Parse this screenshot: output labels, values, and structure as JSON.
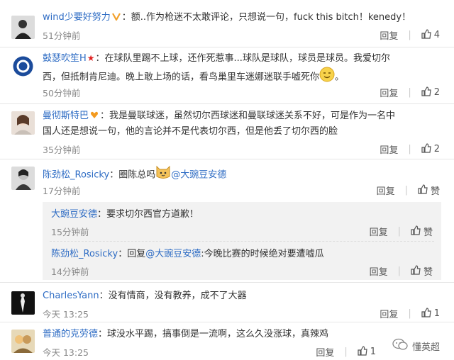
{
  "comments": [
    {
      "name": "wind少要好努力",
      "text": "：额..作为枪迷不太敢评论，只想说一句，fuck this bitch！kenedy！",
      "time": "51分钟前",
      "reply_label": "回复",
      "like_count": "4"
    },
    {
      "name": "鼓瑟吹笙H",
      "text_line1": "：在球队里踢不上球，还作死惹事...球队是球队，球员是球员。我爱切尔",
      "text_line2": "西，但抵制肯尼迪。晚上敢上场的话，看鸟巢里车迷娜迷联手嘘死你",
      "time": "50分钟前",
      "reply_label": "回复",
      "like_count": "2"
    },
    {
      "name": "曼彻斯特巴",
      "text_line1": "：我是曼联球迷，虽然切尔西球迷和曼联球迷关系不好，可是作为一名中",
      "text_line2": "国人还是想说一句，他的言论并不是代表切尔西，但是他丢了切尔西的脸",
      "time": "35分钟前",
      "reply_label": "回复",
      "like_count": "2"
    },
    {
      "name": "陈劲松_Rosicky",
      "text_a": "：圈陈总吗",
      "mention": "@大豌豆安德",
      "time": "17分钟前",
      "reply_label": "回复",
      "like_label": "赞",
      "replies": [
        {
          "name": "大豌豆安德",
          "text": "：要求切尔西官方道歉！",
          "time": "15分钟前",
          "reply_label": "回复",
          "like_label": "赞"
        },
        {
          "name": "陈劲松_Rosicky",
          "text_a": "：回复",
          "mention": "@大豌豆安德",
          "text_b": ":今晚比赛的时候绝对要遭嘘瓜",
          "time": "14分钟前",
          "reply_label": "回复",
          "like_label": "赞"
        }
      ]
    },
    {
      "name": "CharlesYann",
      "text": "：没有情商，没有教养，成不了大器",
      "time": "今天 13:25",
      "reply_label": "回复",
      "like_count": "1"
    },
    {
      "name": "普通的克劳德",
      "text": "：球没水平踢，搞事倒是一流啊，这么久没涨球，真辣鸡",
      "time": "今天 13:25",
      "reply_label": "回复",
      "like_count": "1"
    }
  ],
  "watermark": {
    "text": "懂英超"
  },
  "colors": {
    "link": "#2e6cc4",
    "text": "#333333",
    "muted": "#888888",
    "reply_bg": "#f2f2f2"
  }
}
